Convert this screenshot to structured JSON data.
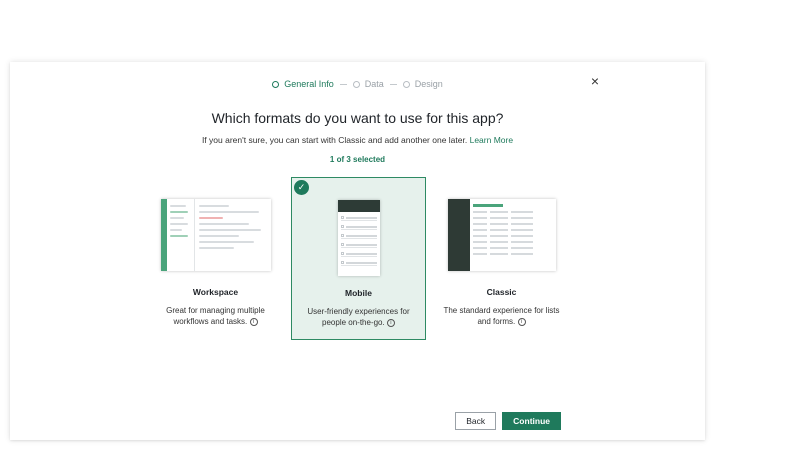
{
  "stepper": {
    "steps": [
      "General Info",
      "Data",
      "Design"
    ],
    "active_index": 0
  },
  "close_label": "×",
  "title": "Which formats do you want to use for this app?",
  "subtitle": {
    "text": "If you aren't sure, you can start with Classic and add another one later.",
    "link": "Learn More"
  },
  "selection_count": "1 of 3 selected",
  "cards": [
    {
      "name": "Workspace",
      "desc_line1": "Great for managing multiple",
      "desc_line2": "workflows and tasks.",
      "selected": false
    },
    {
      "name": "Mobile",
      "desc_line1": "User-friendly experiences for",
      "desc_line2": "people on-the-go.",
      "selected": true
    },
    {
      "name": "Classic",
      "desc_line1": "The standard experience for lists",
      "desc_line2": "and forms.",
      "selected": false
    }
  ],
  "info_glyph": "i",
  "check_glyph": "✓",
  "footer": {
    "back_label": "Back",
    "continue_label": "Continue"
  },
  "colors": {
    "accent": "#1f7a5c",
    "selected_bg": "#e6f1ec"
  }
}
